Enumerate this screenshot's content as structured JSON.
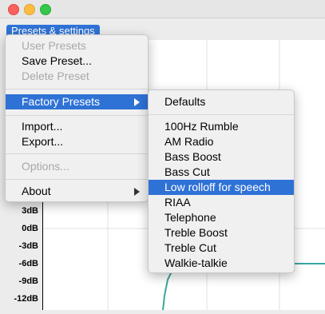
{
  "window": {
    "controls": [
      "close-icon",
      "minimize-icon",
      "zoom-icon"
    ]
  },
  "menubar": {
    "presets_button": "Presets & settings"
  },
  "graph": {
    "y_axis_labels": [
      "3dB",
      "0dB",
      "-3dB",
      "-6dB",
      "-9dB",
      "-12dB"
    ],
    "curve_color": "#3aa6a0"
  },
  "menu": {
    "user_presets": "User Presets",
    "save_preset": "Save Preset...",
    "delete_preset": "Delete Preset",
    "factory_presets": "Factory Presets",
    "import": "Import...",
    "export": "Export...",
    "options": "Options...",
    "about": "About"
  },
  "submenu": {
    "defaults": "Defaults",
    "items": [
      "100Hz Rumble",
      "AM Radio",
      "Bass Boost",
      "Bass Cut",
      "Low rolloff for speech",
      "RIAA",
      "Telephone",
      "Treble Boost",
      "Treble Cut",
      "Walkie-talkie"
    ],
    "selected": "Low rolloff for speech"
  },
  "colors": {
    "accent": "#2f72d6"
  }
}
